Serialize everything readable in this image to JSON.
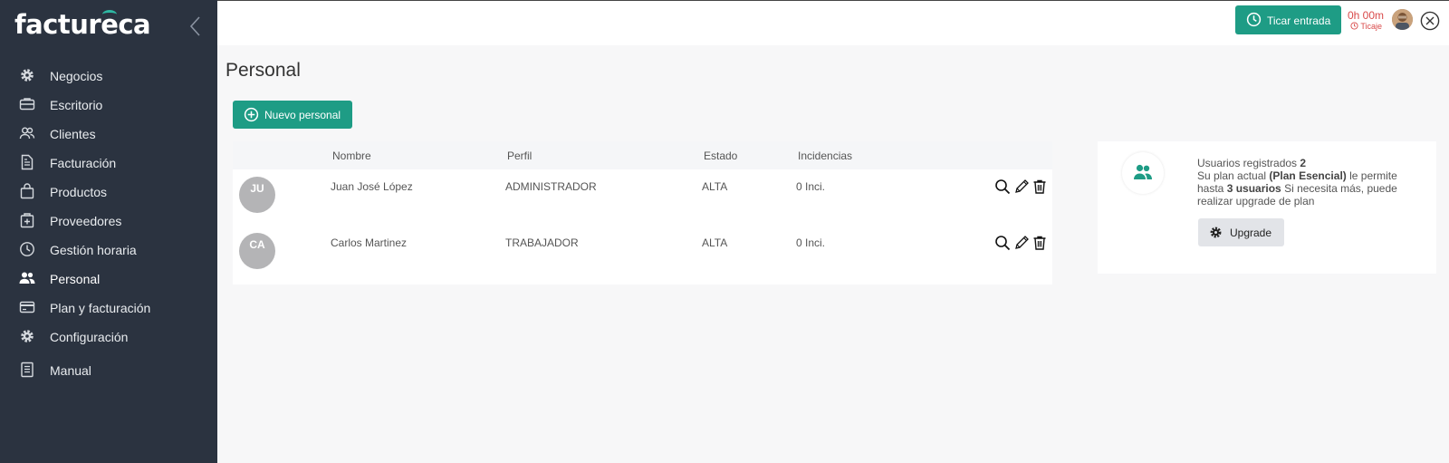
{
  "brand": {
    "logo_pre": "factur",
    "logo_accent": "e",
    "logo_post": "ca"
  },
  "sidebar": {
    "items": [
      {
        "label": "Negocios",
        "icon": "gear-icon"
      },
      {
        "label": "Escritorio",
        "icon": "briefcase-icon"
      },
      {
        "label": "Clientes",
        "icon": "users-icon"
      },
      {
        "label": "Facturación",
        "icon": "document-icon"
      },
      {
        "label": "Productos",
        "icon": "bag-icon"
      },
      {
        "label": "Proveedores",
        "icon": "box-plus-icon"
      },
      {
        "label": "Gestión horaria",
        "icon": "clock-icon"
      },
      {
        "label": "Personal",
        "icon": "team-icon"
      },
      {
        "label": "Plan y facturación",
        "icon": "credit-card-icon"
      },
      {
        "label": "Configuración",
        "icon": "gear-icon"
      },
      {
        "label": "Manual",
        "icon": "manual-icon"
      }
    ],
    "active": "Personal"
  },
  "header": {
    "clock_button": "Ticar entrada",
    "timer": "0h 00m",
    "ticaje": "Ticaje"
  },
  "main": {
    "title": "Personal",
    "new_button": "Nuevo personal",
    "columns": [
      "Nombre",
      "Perfil",
      "Estado",
      "Incidencias"
    ],
    "rows": [
      {
        "initials": "JU",
        "name": "Juan José López",
        "profile": "ADMINISTRADOR",
        "status": "ALTA",
        "incidents": "0 Inci."
      },
      {
        "initials": "CA",
        "name": "Carlos Martinez",
        "profile": "TRABAJADOR",
        "status": "ALTA",
        "incidents": "0 Inci."
      }
    ]
  },
  "card": {
    "registered_label": "Usuarios registrados",
    "registered_count": "2",
    "plan_prefix": "Su plan actual",
    "plan_name": "(Plan Esencial)",
    "plan_mid": "le permite hasta",
    "limit": "3 usuarios",
    "plan_suffix": "Si necesita más, puede realizar upgrade de plan",
    "upgrade_button": "Upgrade"
  },
  "colors": {
    "sidebar": "#2b3340",
    "accent": "#1e9c85",
    "timer": "#d94a4a"
  }
}
